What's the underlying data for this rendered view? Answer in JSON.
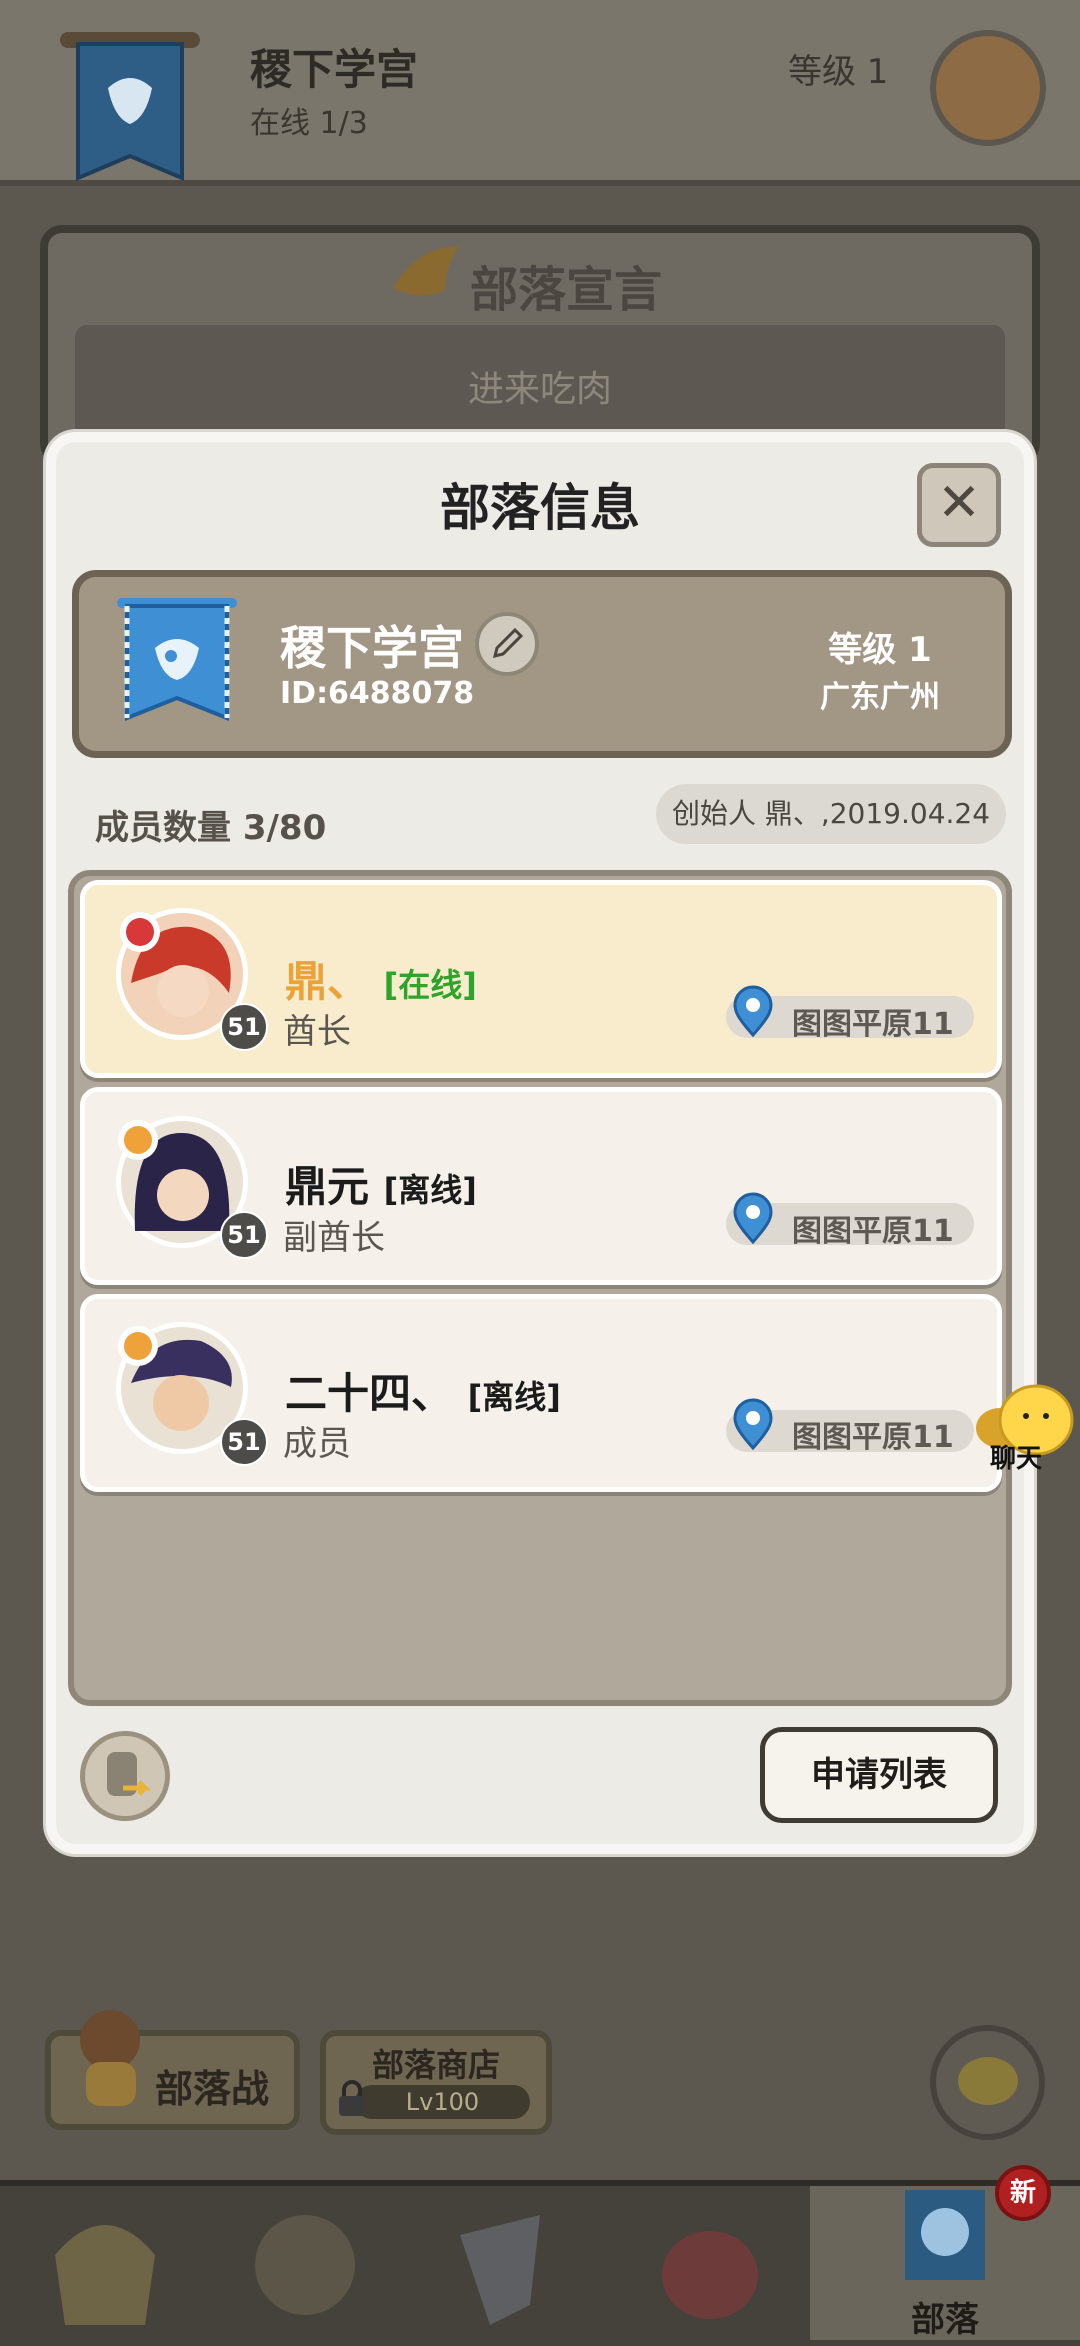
{
  "background": {
    "tribe_name": "稷下学宫",
    "online": "在线 1/3",
    "level": "等级 1",
    "declaration_title": "部落宣言",
    "declaration_text": "进来吃肉",
    "buttons": {
      "tribe_war": "部落战",
      "tribe_shop": "部落商店",
      "tribe_shop_level": "Lv100"
    },
    "nav": {
      "active_label": "部落",
      "badge": "新"
    },
    "float_chat_label": "聊天"
  },
  "modal": {
    "title": "部落信息",
    "close_glyph": "✕",
    "tribe": {
      "name": "稷下学宫",
      "id": "ID:6488078",
      "level": "等级 1",
      "region": "广东广州"
    },
    "member_count": "成员数量 3/80",
    "founder": "创始人 鼎、,2019.04.24",
    "members": [
      {
        "name": "鼎、",
        "status": "[在线]",
        "role": "酋长",
        "level": "51",
        "location": "图图平原11"
      },
      {
        "name": "鼎元",
        "status": "[离线]",
        "role": "副酋长",
        "level": "51",
        "location": "图图平原11"
      },
      {
        "name": "二十四、",
        "status": "[离线]",
        "role": "成员",
        "level": "51",
        "location": "图图平原11"
      }
    ],
    "apply_list_button": "申请列表"
  },
  "colors": {
    "online_green": "#2ea42a",
    "leader_name_orange": "#e9a33a",
    "leader_card_bg": "#f9eccd",
    "card_bg": "#f5f1ea",
    "banner_blue": "#3f8fd4"
  }
}
